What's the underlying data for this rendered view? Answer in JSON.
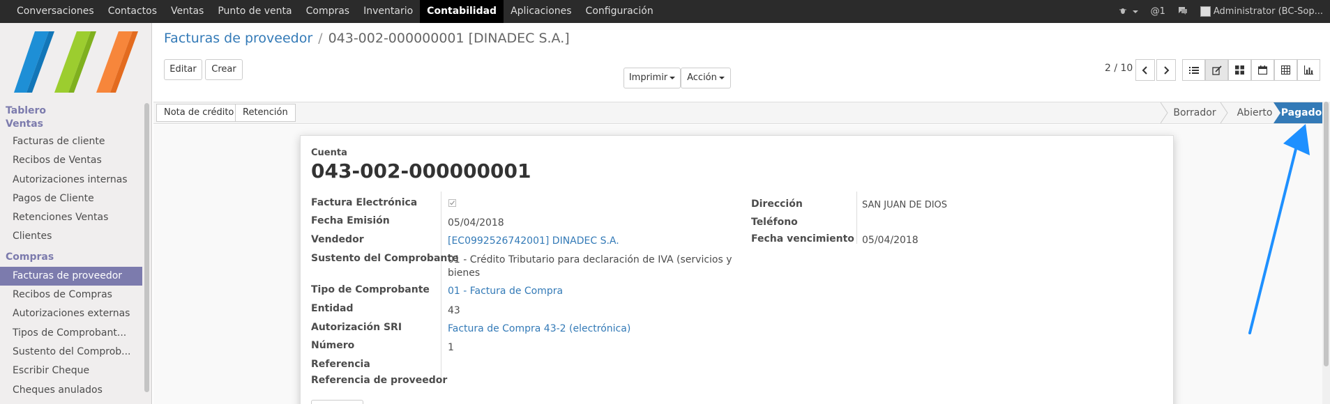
{
  "topbar": {
    "menu": [
      "Conversaciones",
      "Contactos",
      "Ventas",
      "Punto de venta",
      "Compras",
      "Inventario",
      "Contabilidad",
      "Aplicaciones",
      "Configuración"
    ],
    "active_index": 6,
    "notifications": "@1",
    "user": "Administrator (BC-Sop..."
  },
  "sidebar": {
    "head_tablero": "Tablero",
    "head_ventas": "Ventas",
    "ventas_items": [
      "Facturas de cliente",
      "Recibos de Ventas",
      "Autorizaciones internas",
      "Pagos de Cliente",
      "Retenciones Ventas",
      "Clientes"
    ],
    "head_compras": "Compras",
    "compras_items": [
      "Facturas de proveedor",
      "Recibos de Compras",
      "Autorizaciones externas",
      "Tipos de Comprobant...",
      "Sustento del Comprob...",
      "Escribir Cheque",
      "Cheques anulados"
    ],
    "active_item": "Facturas de proveedor"
  },
  "breadcrumb": {
    "parent": "Facturas de proveedor",
    "separator": "/",
    "current": "043-002-000000001 [DINADEC S.A.]"
  },
  "buttons": {
    "edit": "Editar",
    "create": "Crear",
    "print": "Imprimir",
    "action": "Acción"
  },
  "pager": "2 / 10",
  "statusbar": {
    "buttons": [
      "Nota de crédito",
      "Retención"
    ],
    "stages": [
      "Borrador",
      "Abierto",
      "Pagado"
    ],
    "active_stage": "Pagado",
    "active_color": "#337ab7"
  },
  "form": {
    "account_label": "Cuenta",
    "title": "043-002-000000001",
    "left": {
      "electronic_label": "Factura Electrónica",
      "electronic_checked": true,
      "date_label": "Fecha Emisión",
      "date_value": "05/04/2018",
      "vendor_label": "Vendedor",
      "vendor_value": "[EC0992526742001] DINADEC S.A.",
      "support_label": "Sustento del Comprobante",
      "support_value_1": "01 - Crédito Tributario para declaración de IVA (servicios y",
      "support_value_2": "bienes",
      "doctype_label": "Tipo de Comprobante",
      "doctype_value": "01 - Factura de Compra",
      "entity_label": "Entidad",
      "entity_value": "43",
      "auth_label": "Autorización SRI",
      "auth_value": "Factura de Compra 43-2 (electrónica)",
      "number_label": "Número",
      "number_value": "1",
      "ref_label": "Referencia",
      "vendor_ref_label": "Referencia de proveedor"
    },
    "right": {
      "address_label": "Dirección",
      "address_value": "SAN JUAN DE DIOS",
      "phone_label": "Teléfono",
      "due_label": "Fecha vencimiento",
      "due_value": "05/04/2018"
    }
  },
  "colors": {
    "brand": "#7c7bad",
    "link": "#337ab7",
    "annotation_arrow": "#1e90ff"
  }
}
